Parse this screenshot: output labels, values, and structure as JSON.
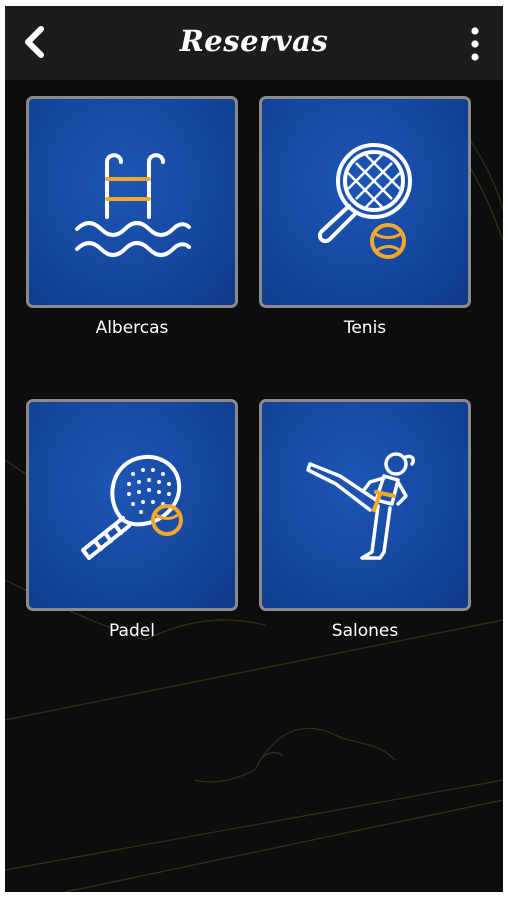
{
  "header": {
    "title": "Reservas",
    "back_icon": "chevron-left-icon",
    "menu_icon": "more-vertical-icon"
  },
  "tiles": [
    {
      "label": "Albercas",
      "icon": "pool-ladder-icon"
    },
    {
      "label": "Tenis",
      "icon": "tennis-racket-icon"
    },
    {
      "label": "Padel",
      "icon": "padel-racket-icon"
    },
    {
      "label": "Salones",
      "icon": "martial-arts-kick-icon"
    }
  ],
  "colors": {
    "background": "#0d0d0d",
    "topbar": "#1c1c1c",
    "tile_blue": "#1548a0",
    "accent_yellow": "#f2a92b",
    "icon_white": "#ffffff"
  }
}
